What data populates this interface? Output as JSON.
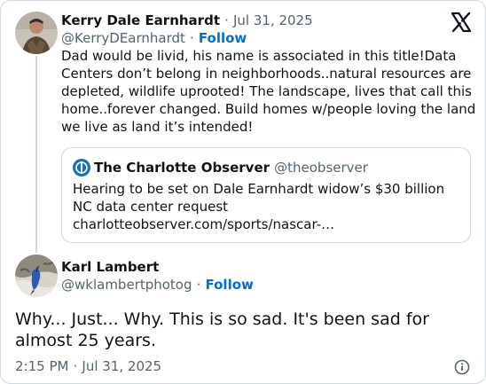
{
  "tweet": {
    "author_name": "Kerry Dale Earnhardt",
    "separator": "·",
    "date": "Jul 31, 2025",
    "handle": "@KerryDEarnhardt",
    "follow_label": "Follow",
    "text": "Dad would be livid, his name is associated in this title!Data Centers don’t belong in neighborhoods..natural resources are depleted, wildlife uprooted! The landscape, lives that call this home..forever changed. Build homes w/people loving the land we live as land it’s intended!",
    "avatar_icon": "person-avatar",
    "quote": {
      "source_name": "The Charlotte Observer",
      "source_handle": "@theobserver",
      "logo_icon": "charlotte-observer-logo",
      "headline": "Hearing to be set on Dale Earnhardt widow’s $30 billion NC data center request",
      "link": "charlotteobserver.com/sports/nascar-…"
    }
  },
  "reply": {
    "author_name": "Karl Lambert",
    "handle": "@wklambertphotog",
    "separator": "·",
    "follow_label": "Follow",
    "text": "Why... Just... Why. This is so sad. It's been sad for almost 25 years.",
    "time": "2:15 PM",
    "date": "Jul 31, 2025",
    "avatar_icon": "bird-photo-avatar"
  },
  "icons": {
    "brand": "x-logo-icon",
    "info": "info-icon"
  },
  "colors": {
    "link_blue": "#006fd6",
    "muted_gray": "#536471",
    "border": "#cfd9de",
    "text": "#0f1419"
  }
}
